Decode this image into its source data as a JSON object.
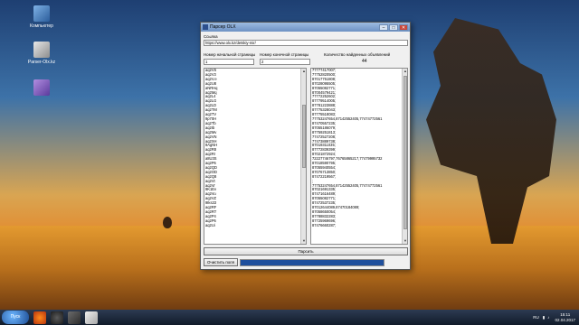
{
  "desktop": {
    "icons": [
      {
        "label": "Компьютер"
      },
      {
        "label": "Parser-Olx.kz"
      },
      {
        "label": ""
      }
    ]
  },
  "window": {
    "title": "Парсер OLX",
    "controls": {
      "minimize": "–",
      "maximize": "□",
      "close": "✕"
    },
    "url_label": "Ссылка",
    "url_value": "https://www.olx.kz/detskiy-mir/",
    "start_page_label": "Номер начальной страницы",
    "start_page_value": "1",
    "end_page_label": "Номер конечной страницы",
    "end_page_value": "2",
    "count_label": "Количество найденных объявлений",
    "count_value": "44",
    "ids": [
      "aq2VS",
      "aq2V3",
      "aq2V.e",
      "aq2U8",
      "aNRHq",
      "aq2Mq",
      "aq2L4",
      "aq2LG",
      "aq2LD",
      "aq2TM",
      "aq2TV",
      "9p70H",
      "aq2Tb",
      "aq2Ib",
      "aq2Mv",
      "aq2VN",
      "aq2XH",
      "9AgNH",
      "aq2R8",
      "aq2Rr",
      "a8U3S",
      "aq2P6",
      "aq2QD",
      "aq2OD",
      "aq2Q8",
      "aq2Vt",
      "aq2Vr",
      "9K1Ev",
      "aq2Vu",
      "aq2VZ",
      "9Iks33",
      "aq2RF",
      "aq2RT",
      "aq2P4",
      "aq2P6",
      "aq2Ui"
    ],
    "phones": [
      "77777417007;",
      "77752820500;",
      "87017751808;",
      "87028095505;",
      "87055082771;",
      "87004579421;",
      "77772252602;",
      "87779514005;",
      "87781223888;",
      "87775328043;",
      "87775518083;",
      "77753247654,87142552405,77474772561",
      "87470557235;",
      "87055186079;",
      "87759251813;",
      "77472527208;",
      "77473889738;",
      "87019311035;",
      "87772839399;",
      "87021872924;",
      "72227746797,76765865217,77479995732",
      "87018590795;",
      "87055940554;",
      "87076713850;",
      "87472219567;",
      "",
      ";",
      "77753247654,87142552405,77474772561",
      "87021691335;",
      "87471616489;",
      "87055082771;",
      "87472537235;",
      "87012644089,87470184089;",
      "87058650054;",
      "87788832283;",
      "87725969696;",
      "87476660287;"
    ],
    "clear_button": "Очистить поля",
    "parse_button": "Парсить",
    "progress": 1.0
  },
  "taskbar": {
    "start_label": "Пуск",
    "lang": "RU",
    "time": "15:11",
    "date": "02.04.2017"
  }
}
